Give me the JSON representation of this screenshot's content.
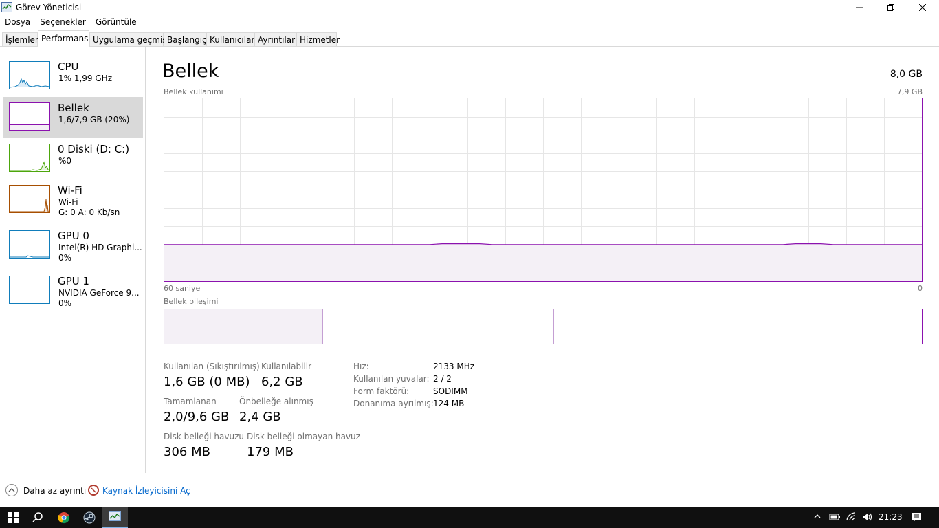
{
  "window": {
    "title": "Görev Yöneticisi"
  },
  "menu": [
    "Dosya",
    "Seçenekler",
    "Görüntüle"
  ],
  "tabs": [
    "İşlemler",
    "Performans",
    "Uygulama geçmişi",
    "Başlangıç",
    "Kullanıcılar",
    "Ayrıntılar",
    "Hizmetler"
  ],
  "active_tab": "Performans",
  "sidebar": {
    "items": [
      {
        "title": "CPU",
        "line1": "1%  1,99 GHz",
        "line2": "",
        "color": "#117dbb"
      },
      {
        "title": "Bellek",
        "line1": "1,6/7,9 GB (20%)",
        "line2": "",
        "color": "#8b12ae"
      },
      {
        "title": "0 Diski (D: C:)",
        "line1": "%0",
        "line2": "",
        "color": "#4da60c"
      },
      {
        "title": "Wi-Fi",
        "line1": "Wi-Fi",
        "line2": "G: 0 A: 0 Kb/sn",
        "color": "#a74f01"
      },
      {
        "title": "GPU 0",
        "line1": "Intel(R) HD Graphi...",
        "line2": "0%",
        "color": "#117dbb"
      },
      {
        "title": "GPU 1",
        "line1": "NVIDIA GeForce 9...",
        "line2": "0%",
        "color": "#117dbb"
      }
    ]
  },
  "main": {
    "title": "Bellek",
    "total": "8,0 GB",
    "usage_label": "Bellek kullanımı",
    "usage_max": "7,9 GB",
    "time_span": "60 saniye",
    "axis_min": "0",
    "composition_label": "Bellek bileşimi",
    "accent_color": "#8b12ae",
    "usage_fraction": 0.2,
    "composition_fractions": {
      "in_use": 0.21,
      "standby": 0.305,
      "free": 0.485
    }
  },
  "stats": {
    "in_use_label": "Kullanılan (Sıkıştırılmış)",
    "in_use_value": "1,6 GB (0 MB)",
    "available_label": "Kullanılabilir",
    "available_value": "6,2 GB",
    "committed_label": "Tamamlanan",
    "committed_value": "2,0/9,6 GB",
    "cached_label": "Önbelleğe alınmış",
    "cached_value": "2,4 GB",
    "paged_label": "Disk belleği havuzu",
    "paged_value": "306 MB",
    "nonpaged_label": "Disk belleği olmayan havuz",
    "nonpaged_value": "179 MB"
  },
  "specs": {
    "speed_label": "Hız:",
    "speed_value": "2133 MHz",
    "slots_label": "Kullanılan yuvalar:",
    "slots_value": "2 / 2",
    "form_label": "Form faktörü:",
    "form_value": "SODIMM",
    "reserved_label": "Donanıma ayrılmış:",
    "reserved_value": "124 MB"
  },
  "footer": {
    "fewer_details": "Daha az ayrıntı",
    "resource_monitor": "Kaynak İzleyicisini Aç"
  },
  "taskbar": {
    "clock": "21:23",
    "icons": [
      "windows-start-icon",
      "search-icon",
      "chrome-icon",
      "steam-icon",
      "task-manager-icon"
    ]
  }
}
